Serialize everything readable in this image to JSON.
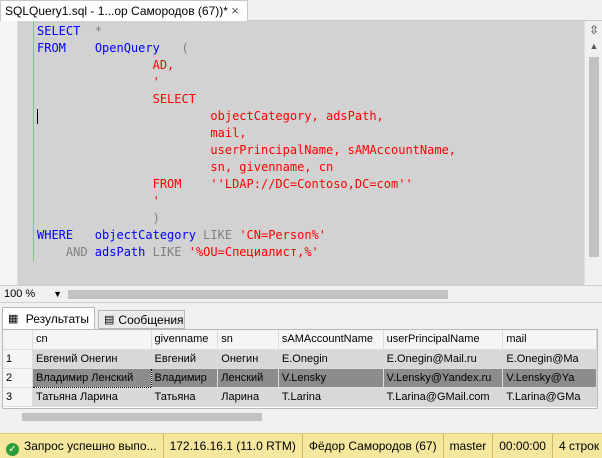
{
  "document_tab": {
    "label": "SQLQuery1.sql - 1...ор Самородов (67))*",
    "close_glyph": "×"
  },
  "editor": {
    "lines": [
      [
        {
          "t": "SELECT",
          "c": "kw"
        },
        {
          "t": "  *",
          "c": "gr"
        }
      ],
      [
        {
          "t": "FROM",
          "c": "kw"
        },
        {
          "t": "    ",
          "c": "gr"
        },
        {
          "t": "OpenQuery",
          "c": "fn"
        },
        {
          "t": "   (",
          "c": "gr"
        }
      ],
      [
        {
          "t": "                AD,",
          "c": "str"
        }
      ],
      [
        {
          "t": "                '",
          "c": "str"
        }
      ],
      [
        {
          "t": "                SELECT",
          "c": "str"
        }
      ],
      [
        {
          "t": "                        objectCategory, adsPath,",
          "c": "str"
        }
      ],
      [
        {
          "t": "                        mail,",
          "c": "str"
        }
      ],
      [
        {
          "t": "                        userPrincipalName, sAMAccountName,",
          "c": "str"
        }
      ],
      [
        {
          "t": "                        sn, givenname, cn",
          "c": "str"
        }
      ],
      [
        {
          "t": "                FROM    ''LDAP://DC=Contoso,DC=com''",
          "c": "str"
        }
      ],
      [
        {
          "t": "                '",
          "c": "str"
        }
      ],
      [
        {
          "t": "                )",
          "c": "gr"
        }
      ],
      [
        {
          "t": "WHERE",
          "c": "kw"
        },
        {
          "t": "   objectCategory",
          "c": "fn"
        },
        {
          "t": " LIKE ",
          "c": "gr"
        },
        {
          "t": "'CN=Person%'",
          "c": "str"
        }
      ],
      [
        {
          "t": "    AND ",
          "c": "gr"
        },
        {
          "t": "adsPath",
          "c": "fn"
        },
        {
          "t": " LIKE ",
          "c": "gr"
        },
        {
          "t": "'%OU=Специалист,%'",
          "c": "str"
        }
      ]
    ]
  },
  "zoom": {
    "value": "100 %"
  },
  "results_tabs": [
    {
      "label": "Результаты",
      "icon": "grid-icon"
    },
    {
      "label": "Сообщения",
      "icon": "messages-icon"
    }
  ],
  "grid": {
    "columns": [
      "cn",
      "givenname",
      "sn",
      "sAMAccountName",
      "userPrincipalName",
      "mail"
    ],
    "rows": [
      [
        "1",
        "Евгений Онегин",
        "Евгений",
        "Онегин",
        "E.Onegin",
        "E.Onegin@Mail.ru",
        "E.Onegin@Ma"
      ],
      [
        "2",
        "Владимир Ленский",
        "Владимир",
        "Ленский",
        "V.Lensky",
        "V.Lensky@Yandex.ru",
        "V.Lensky@Ya"
      ],
      [
        "3",
        "Татьяна Ларина",
        "Татьяна",
        "Ларина",
        "T.Larina",
        "T.Larina@GMail.com",
        "T.Larina@GMa"
      ]
    ]
  },
  "status": {
    "message": "Запрос успешно выпо...",
    "server": "172.16.16.1 (11.0 RTM)",
    "user": "Фёдор Самородов (67)",
    "database": "master",
    "elapsed": "00:00:00",
    "rows": "4 строк"
  }
}
